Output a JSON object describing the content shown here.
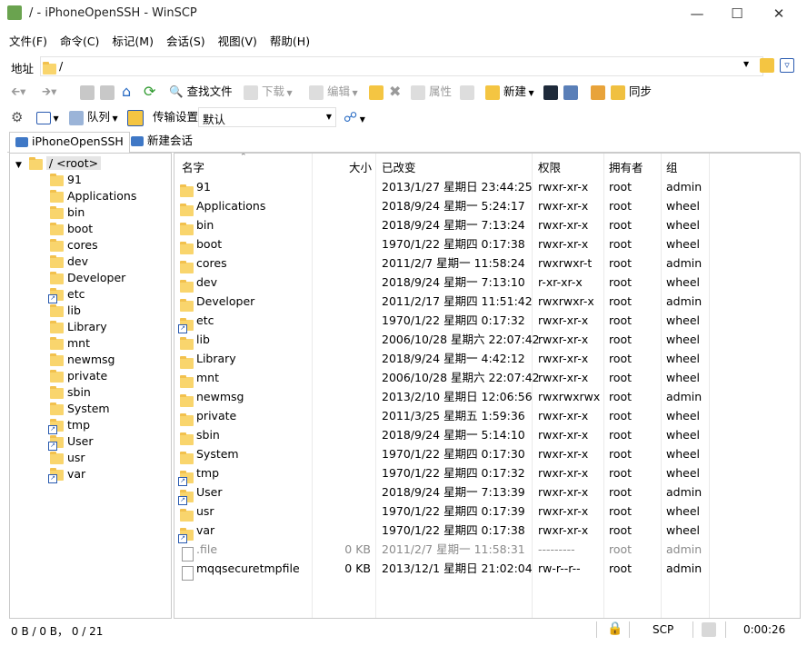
{
  "window": {
    "title": "/ - iPhoneOpenSSH - WinSCP"
  },
  "menu": [
    "文件(F)",
    "命令(C)",
    "标记(M)",
    "会话(S)",
    "视图(V)",
    "帮助(H)"
  ],
  "address": {
    "label": "地址",
    "value": "/"
  },
  "toolbar1": {
    "find": "查找文件",
    "download": "下载",
    "edit": "编辑",
    "properties": "属性",
    "new": "新建",
    "sync": "同步"
  },
  "toolbar2": {
    "queue": "队列",
    "transfer_label": "传输设置",
    "transfer_value": "默认"
  },
  "tabs": [
    {
      "label": "iPhoneOpenSSH"
    },
    {
      "label": "新建会话"
    }
  ],
  "tree": {
    "root": "/ <root>",
    "items": [
      {
        "name": "91",
        "link": false
      },
      {
        "name": "Applications",
        "link": false
      },
      {
        "name": "bin",
        "link": false
      },
      {
        "name": "boot",
        "link": false
      },
      {
        "name": "cores",
        "link": false
      },
      {
        "name": "dev",
        "link": false
      },
      {
        "name": "Developer",
        "link": false
      },
      {
        "name": "etc",
        "link": true
      },
      {
        "name": "lib",
        "link": false
      },
      {
        "name": "Library",
        "link": false
      },
      {
        "name": "mnt",
        "link": false
      },
      {
        "name": "newmsg",
        "link": false
      },
      {
        "name": "private",
        "link": false
      },
      {
        "name": "sbin",
        "link": false
      },
      {
        "name": "System",
        "link": false
      },
      {
        "name": "tmp",
        "link": true
      },
      {
        "name": "User",
        "link": true
      },
      {
        "name": "usr",
        "link": false
      },
      {
        "name": "var",
        "link": true
      }
    ]
  },
  "columns": {
    "name": "名字",
    "size": "大小",
    "changed": "已改变",
    "rights": "权限",
    "owner": "拥有者",
    "group": "组"
  },
  "files": [
    {
      "name": "91",
      "type": "folder",
      "size": "",
      "changed": "2013/1/27 星期日 23:44:25",
      "rights": "rwxr-xr-x",
      "owner": "root",
      "group": "admin"
    },
    {
      "name": "Applications",
      "type": "folder",
      "size": "",
      "changed": "2018/9/24 星期一 5:24:17",
      "rights": "rwxr-xr-x",
      "owner": "root",
      "group": "wheel"
    },
    {
      "name": "bin",
      "type": "folder",
      "size": "",
      "changed": "2018/9/24 星期一 7:13:24",
      "rights": "rwxr-xr-x",
      "owner": "root",
      "group": "wheel"
    },
    {
      "name": "boot",
      "type": "folder",
      "size": "",
      "changed": "1970/1/22 星期四 0:17:38",
      "rights": "rwxr-xr-x",
      "owner": "root",
      "group": "wheel"
    },
    {
      "name": "cores",
      "type": "folder",
      "size": "",
      "changed": "2011/2/7 星期一 11:58:24",
      "rights": "rwxrwxr-t",
      "owner": "root",
      "group": "admin"
    },
    {
      "name": "dev",
      "type": "folder",
      "size": "",
      "changed": "2018/9/24 星期一 7:13:10",
      "rights": "r-xr-xr-x",
      "owner": "root",
      "group": "wheel"
    },
    {
      "name": "Developer",
      "type": "folder",
      "size": "",
      "changed": "2011/2/17 星期四 11:51:42",
      "rights": "rwxrwxr-x",
      "owner": "root",
      "group": "admin"
    },
    {
      "name": "etc",
      "type": "link",
      "size": "",
      "changed": "1970/1/22 星期四 0:17:32",
      "rights": "rwxr-xr-x",
      "owner": "root",
      "group": "wheel"
    },
    {
      "name": "lib",
      "type": "folder",
      "size": "",
      "changed": "2006/10/28 星期六 22:07:42",
      "rights": "rwxr-xr-x",
      "owner": "root",
      "group": "wheel"
    },
    {
      "name": "Library",
      "type": "folder",
      "size": "",
      "changed": "2018/9/24 星期一 4:42:12",
      "rights": "rwxr-xr-x",
      "owner": "root",
      "group": "wheel"
    },
    {
      "name": "mnt",
      "type": "folder",
      "size": "",
      "changed": "2006/10/28 星期六 22:07:42",
      "rights": "rwxr-xr-x",
      "owner": "root",
      "group": "wheel"
    },
    {
      "name": "newmsg",
      "type": "folder",
      "size": "",
      "changed": "2013/2/10 星期日 12:06:56",
      "rights": "rwxrwxrwx",
      "owner": "root",
      "group": "admin"
    },
    {
      "name": "private",
      "type": "folder",
      "size": "",
      "changed": "2011/3/25 星期五 1:59:36",
      "rights": "rwxr-xr-x",
      "owner": "root",
      "group": "wheel"
    },
    {
      "name": "sbin",
      "type": "folder",
      "size": "",
      "changed": "2018/9/24 星期一 5:14:10",
      "rights": "rwxr-xr-x",
      "owner": "root",
      "group": "wheel"
    },
    {
      "name": "System",
      "type": "folder",
      "size": "",
      "changed": "1970/1/22 星期四 0:17:30",
      "rights": "rwxr-xr-x",
      "owner": "root",
      "group": "wheel"
    },
    {
      "name": "tmp",
      "type": "link",
      "size": "",
      "changed": "1970/1/22 星期四 0:17:32",
      "rights": "rwxr-xr-x",
      "owner": "root",
      "group": "wheel"
    },
    {
      "name": "User",
      "type": "link",
      "size": "",
      "changed": "2018/9/24 星期一 7:13:39",
      "rights": "rwxr-xr-x",
      "owner": "root",
      "group": "admin"
    },
    {
      "name": "usr",
      "type": "folder",
      "size": "",
      "changed": "1970/1/22 星期四 0:17:39",
      "rights": "rwxr-xr-x",
      "owner": "root",
      "group": "wheel"
    },
    {
      "name": "var",
      "type": "link",
      "size": "",
      "changed": "1970/1/22 星期四 0:17:38",
      "rights": "rwxr-xr-x",
      "owner": "root",
      "group": "wheel"
    },
    {
      "name": ".file",
      "type": "file-hidden",
      "size": "0 KB",
      "changed": "2011/2/7 星期一 11:58:31",
      "rights": "---------",
      "owner": "root",
      "group": "admin"
    },
    {
      "name": "mqqsecuretmpfile",
      "type": "file",
      "size": "0 KB",
      "changed": "2013/12/1 星期日 21:02:04",
      "rights": "rw-r--r--",
      "owner": "root",
      "group": "admin"
    }
  ],
  "status": {
    "selection": "0 B / 0 B， 0 / 21",
    "protocol": "SCP",
    "elapsed": "0:00:26"
  }
}
